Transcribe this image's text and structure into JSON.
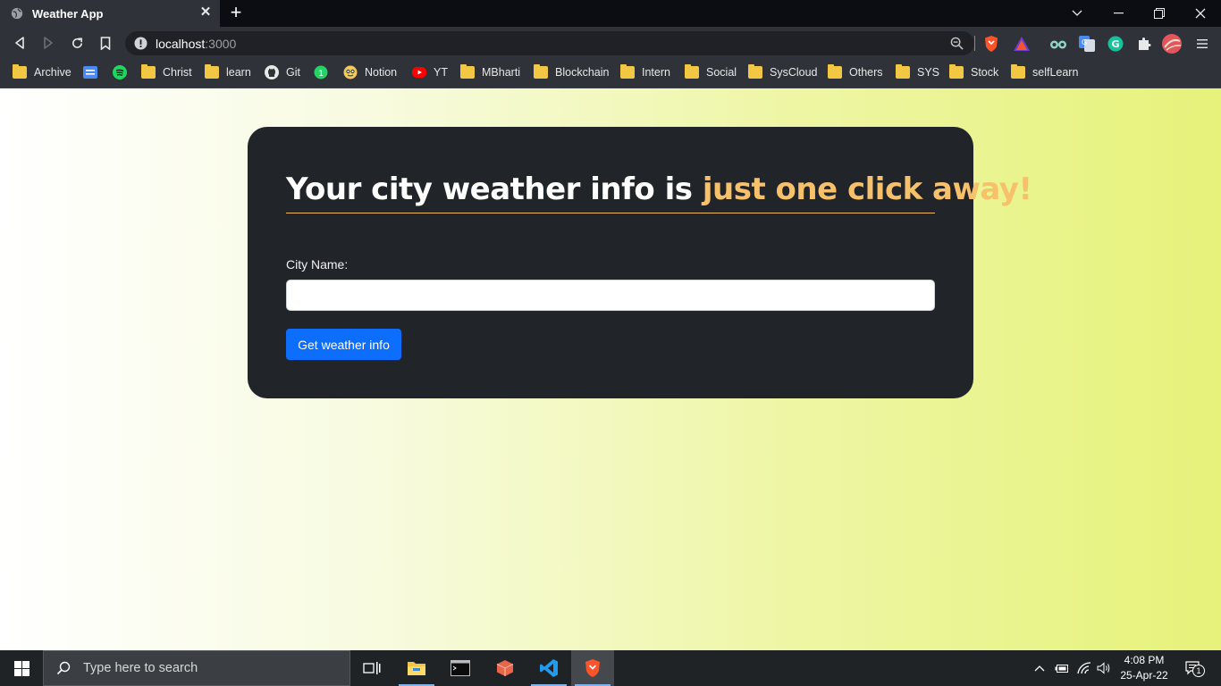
{
  "browser": {
    "tab_title": "Weather App",
    "tab_close_glyph": "✕",
    "new_tab_glyph": "+",
    "url_host": "localhost",
    "url_port": ":3000"
  },
  "bookmarks": [
    {
      "label": "Archive",
      "icon": "folder"
    },
    {
      "label": "",
      "icon": "google-forms"
    },
    {
      "label": "",
      "icon": "spotify"
    },
    {
      "label": "Christ",
      "icon": "folder"
    },
    {
      "label": "learn",
      "icon": "folder"
    },
    {
      "label": "Git",
      "icon": "github"
    },
    {
      "label": "",
      "icon": "whatsapp"
    },
    {
      "label": "Notion",
      "icon": "notion"
    },
    {
      "label": "YT",
      "icon": "youtube"
    },
    {
      "label": "MBharti",
      "icon": "folder"
    },
    {
      "label": "Blockchain",
      "icon": "folder"
    },
    {
      "label": "Intern",
      "icon": "folder"
    },
    {
      "label": "Social",
      "icon": "folder"
    },
    {
      "label": "SysCloud",
      "icon": "folder"
    },
    {
      "label": "Others",
      "icon": "folder"
    },
    {
      "label": "SYS",
      "icon": "folder"
    },
    {
      "label": "Stock",
      "icon": "folder"
    },
    {
      "label": "selfLearn",
      "icon": "folder"
    }
  ],
  "page": {
    "heading_main": "Your city weather info is ",
    "heading_highlight": "just one click away!",
    "city_label": "City Name:",
    "city_value": "",
    "submit_label": "Get weather info"
  },
  "taskbar": {
    "search_placeholder": "Type here to search",
    "time": "4:08 PM",
    "date": "25-Apr-22",
    "notification_count": "1"
  },
  "colors": {
    "card_bg": "#212429",
    "heading_highlight": "#f7c06a",
    "button_primary": "#0d6efd"
  }
}
